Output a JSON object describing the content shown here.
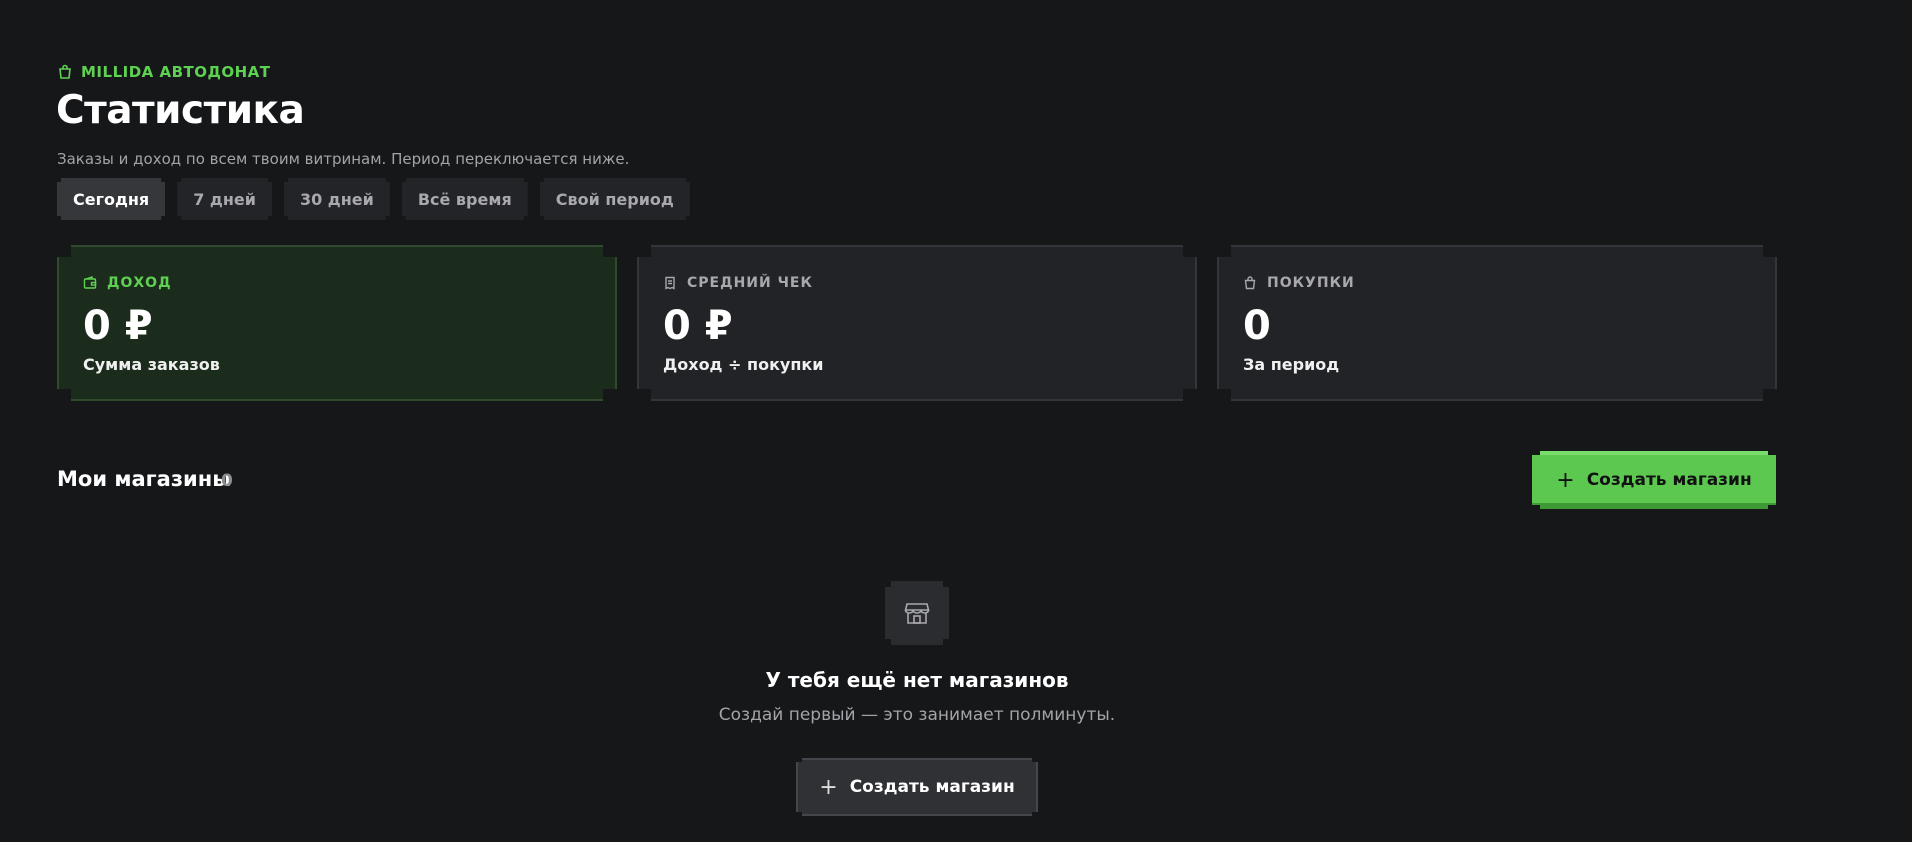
{
  "header": {
    "brand": "MILLIDA АВТОДОНАТ",
    "brand_icon": "shopping-bag-icon",
    "title": "Статистика",
    "subtitle": "Заказы и доход по всем твоим витринам. Период переключается ниже."
  },
  "periods": [
    {
      "label": "Сегодня",
      "active": true
    },
    {
      "label": "7 дней",
      "active": false
    },
    {
      "label": "30 дней",
      "active": false
    },
    {
      "label": "Всё время",
      "active": false
    },
    {
      "label": "Свой период",
      "active": false
    }
  ],
  "stats": [
    {
      "label": "ДОХОД",
      "value": "0 ₽",
      "caption": "Сумма заказов",
      "icon": "wallet-icon"
    },
    {
      "label": "СРЕДНИЙ ЧЕК",
      "value": "0 ₽",
      "caption": "Доход ÷ покупки",
      "icon": "receipt-icon"
    },
    {
      "label": "ПОКУПКИ",
      "value": "0",
      "caption": "За период",
      "icon": "shopping-bag-icon"
    }
  ],
  "shops": {
    "title": "Мои магазины",
    "count": "0",
    "create_button": "Создать магазин",
    "empty": {
      "icon": "store-icon",
      "title": "У тебя ещё нет магазинов",
      "text": "Создай первый — это занимает полминуты.",
      "button": "Создать магазин"
    }
  },
  "colors": {
    "accent": "#5fd152",
    "background": "#161719",
    "card": "#222326",
    "card_green": "#1c2c1c"
  }
}
